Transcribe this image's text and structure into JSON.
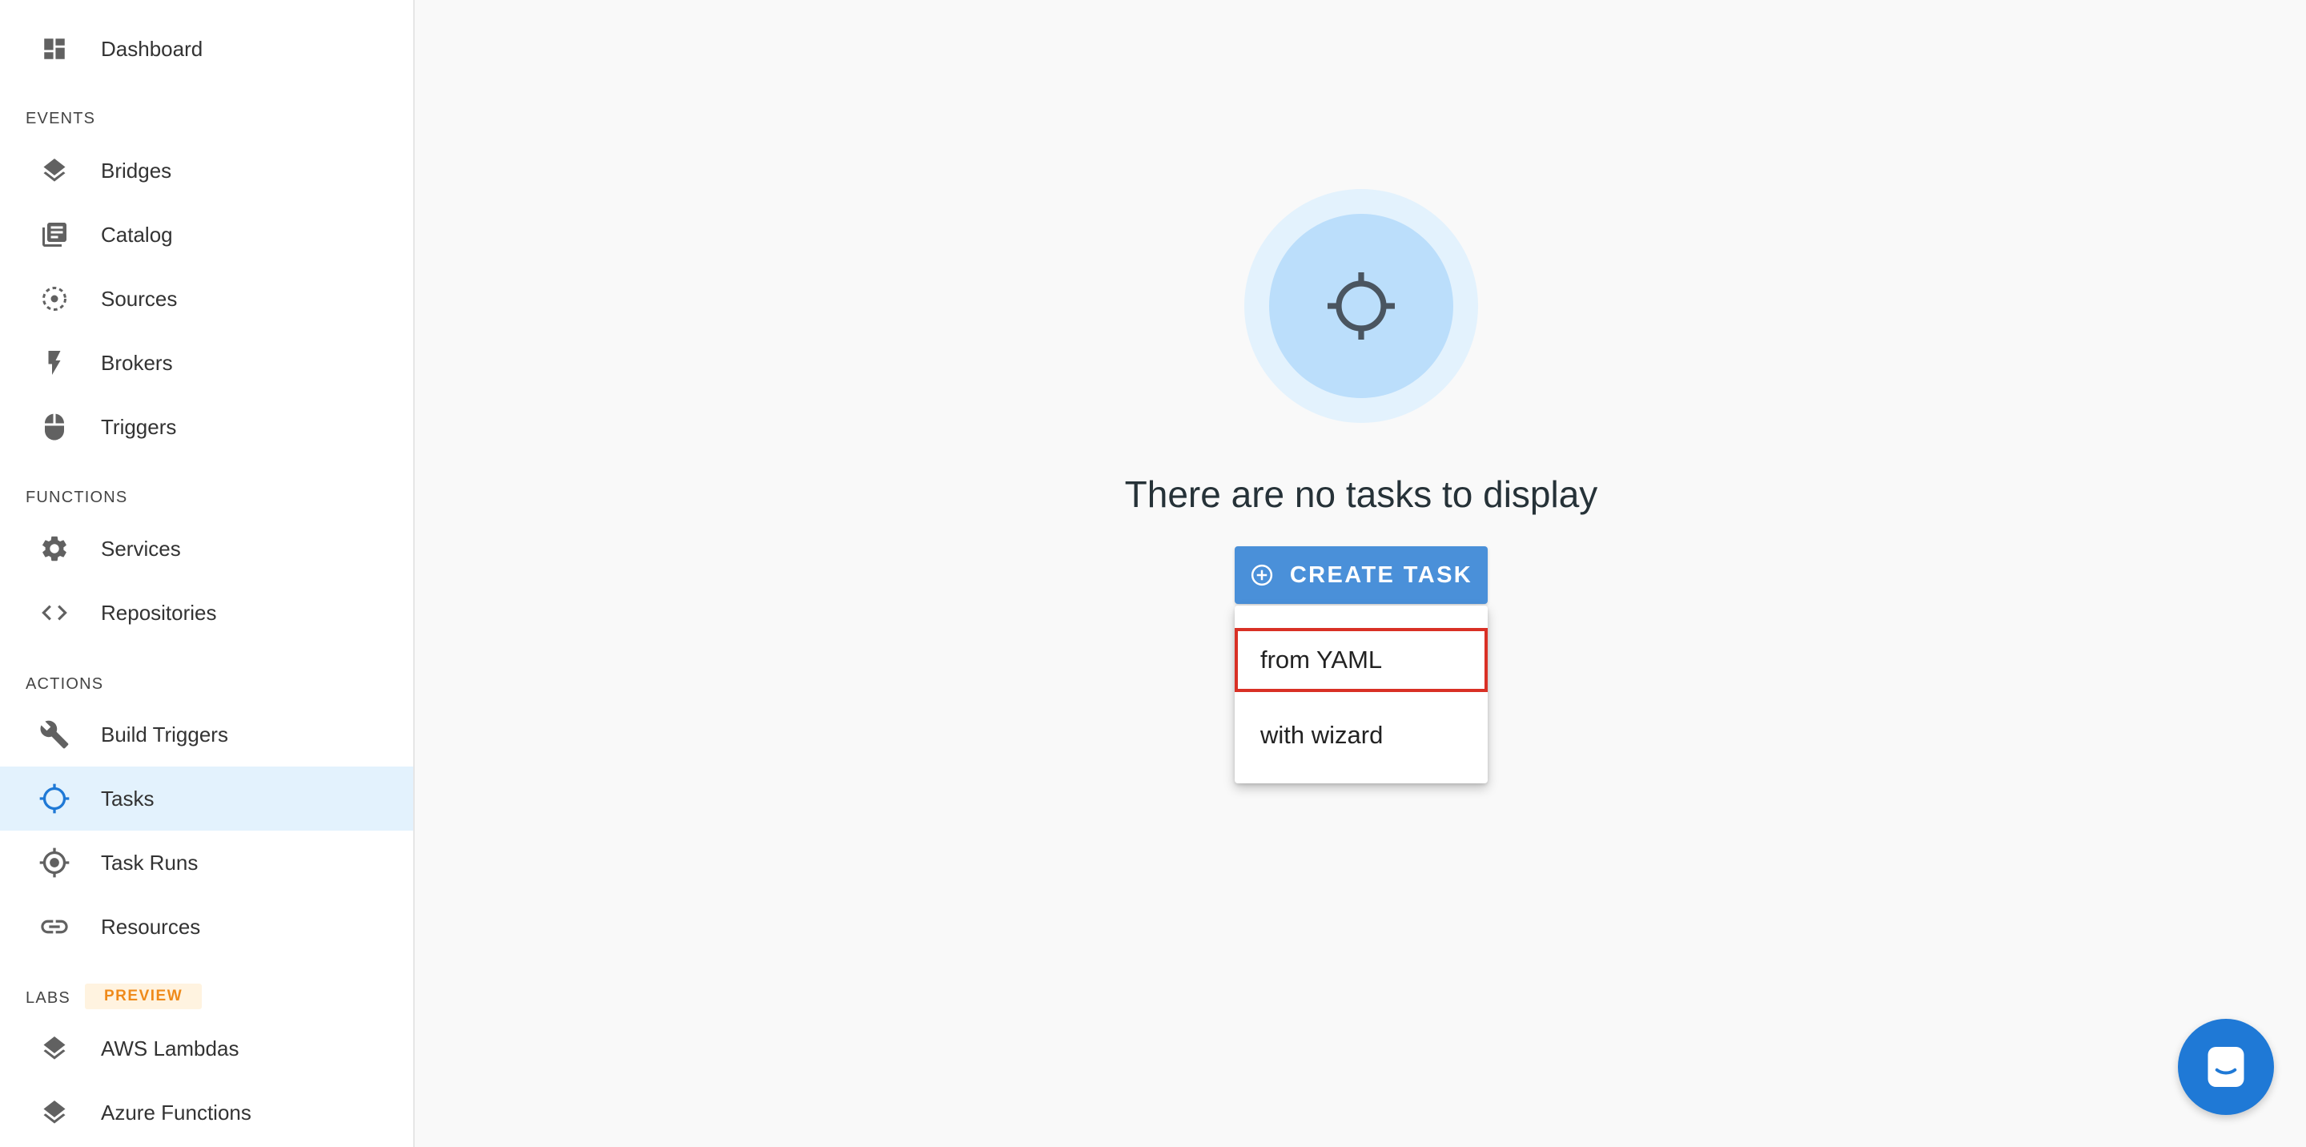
{
  "sidebar": {
    "items": [
      {
        "label": "Dashboard",
        "icon": "dashboard-icon"
      },
      {
        "label": "Bridges",
        "icon": "layers-icon"
      },
      {
        "label": "Catalog",
        "icon": "catalog-icon"
      },
      {
        "label": "Sources",
        "icon": "sources-icon"
      },
      {
        "label": "Brokers",
        "icon": "bolt-icon"
      },
      {
        "label": "Triggers",
        "icon": "mouse-icon"
      },
      {
        "label": "Services",
        "icon": "gear-icon"
      },
      {
        "label": "Repositories",
        "icon": "code-icon"
      },
      {
        "label": "Build Triggers",
        "icon": "wrench-icon"
      },
      {
        "label": "Tasks",
        "icon": "crosshair-icon",
        "active": true
      },
      {
        "label": "Task Runs",
        "icon": "target-icon"
      },
      {
        "label": "Resources",
        "icon": "link-icon"
      },
      {
        "label": "AWS Lambdas",
        "icon": "layers-icon"
      },
      {
        "label": "Azure Functions",
        "icon": "layers-icon"
      }
    ],
    "sections": {
      "events": "EVENTS",
      "functions": "FUNCTIONS",
      "actions": "ACTIONS",
      "labs": "LABS"
    },
    "preview_badge": "PREVIEW"
  },
  "main": {
    "empty_icon": "crosshair-icon",
    "empty_message": "There are no tasks to display",
    "create_button_label": "CREATE TASK",
    "create_menu": [
      {
        "label": "from YAML",
        "highlighted": true
      },
      {
        "label": "with wizard"
      }
    ]
  },
  "chat": {
    "icon": "chat-icon"
  },
  "colors": {
    "accent": "#4a90d9",
    "active_bg": "#e3f2fd",
    "highlight_border": "#d93025",
    "preview_text": "#ef8a1a",
    "chat_fab": "#1f79d6"
  }
}
